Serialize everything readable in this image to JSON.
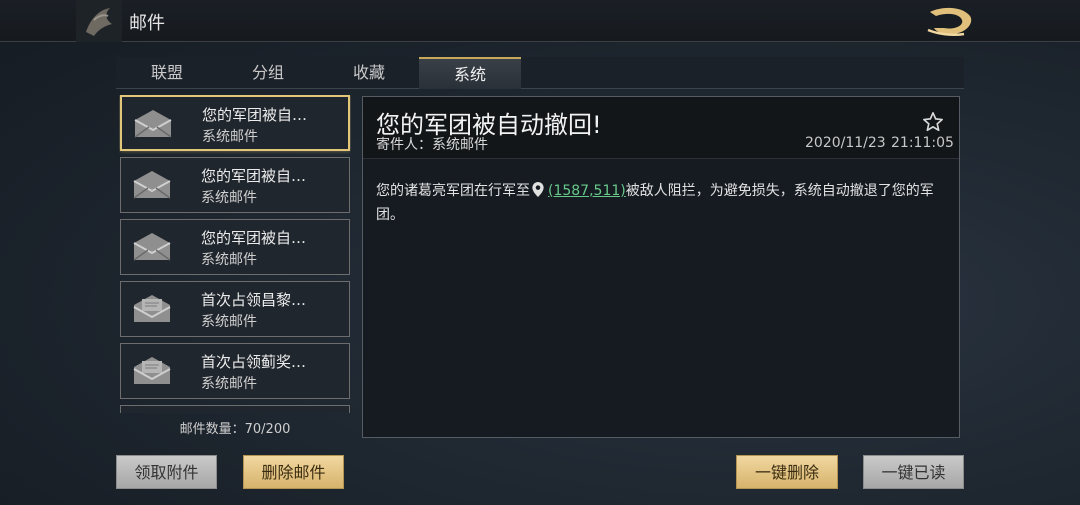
{
  "header": {
    "title": "邮件",
    "emblem_icon": "dragon-emblem-icon",
    "logo_icon": "dragon-logo-icon"
  },
  "tabs": [
    {
      "label": "联盟",
      "active": false
    },
    {
      "label": "分组",
      "active": false
    },
    {
      "label": "收藏",
      "active": false
    },
    {
      "label": "系统",
      "active": true
    }
  ],
  "mail_list": [
    {
      "subject": "您的军团被自…",
      "sender": "系统邮件",
      "icon": "envelope-open-icon",
      "selected": true
    },
    {
      "subject": "您的军团被自…",
      "sender": "系统邮件",
      "icon": "envelope-open-icon",
      "selected": false
    },
    {
      "subject": "您的军团被自…",
      "sender": "系统邮件",
      "icon": "envelope-open-icon",
      "selected": false
    },
    {
      "subject": "首次占领昌黎…",
      "sender": "系统邮件",
      "icon": "envelope-attachment-icon",
      "selected": false
    },
    {
      "subject": "首次占领蓟奖…",
      "sender": "系统邮件",
      "icon": "envelope-attachment-icon",
      "selected": false
    }
  ],
  "mail_count": "邮件数量：70/200",
  "detail": {
    "title": "您的军团被自动撤回!",
    "sender": "寄件人：系统邮件",
    "date": "2020/11/23",
    "time": "21:11:05",
    "body_before": "您的诸葛亮军团在行军至",
    "coordinates": "(1587,511)",
    "body_after": "被敌人阻拦，为避免损失，系统自动撤退了您的军团。"
  },
  "buttons": {
    "claim_attachments": "领取附件",
    "delete_mail": "删除邮件",
    "delete_all": "一键删除",
    "read_all": "一键已读"
  },
  "colors": {
    "accent_gold": "#d7b36c",
    "link_green": "#67c98a",
    "selected_border": "#e2c67a"
  }
}
